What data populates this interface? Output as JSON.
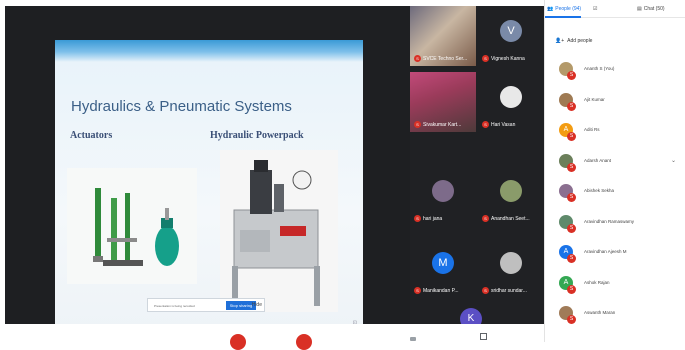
{
  "slide": {
    "title": "Hydraulics & Pneumatic Systems",
    "left_subtitle": "Actuators",
    "right_subtitle": "Hydraulic Powerpack",
    "popup_message": "Presentation is being recorded",
    "popup_button": "Stop sharing",
    "popup_close": "Hide"
  },
  "grid_tiles": [
    {
      "name": "SVCE Techno Ser...",
      "type": "camera",
      "mic": "S"
    },
    {
      "name": "Vignesh Kanna",
      "type": "avatar",
      "letter": "V",
      "color": "#7a8aa8",
      "mic": "S"
    },
    {
      "name": "Sivakumar Kart...",
      "type": "camera",
      "mic": "S"
    },
    {
      "name": "Hari Vasan",
      "type": "photo",
      "mic": "S"
    },
    {
      "name": "hari jana",
      "type": "photo",
      "mic": "S"
    },
    {
      "name": "Anandhan Seet...",
      "type": "photo",
      "mic": "S"
    },
    {
      "name": "Manikandan P...",
      "type": "avatar",
      "letter": "M",
      "color": "#1a73e8",
      "mic": "S"
    },
    {
      "name": "sridhar sundar...",
      "type": "photo",
      "mic": "S"
    }
  ],
  "bottom_tile_letter": "K",
  "panel": {
    "tabs": [
      {
        "label": "People (94)",
        "icon": "people-icon"
      },
      {
        "label": "",
        "icon": "chat-bubble-icon"
      },
      {
        "label": "Chat (50)",
        "icon": "chat-icon"
      }
    ],
    "add_people": "Add people",
    "people": [
      {
        "name": "Ananth S (You)",
        "avatar": "photo",
        "color": "#b49a6a"
      },
      {
        "name": "Ajit Kumar",
        "avatar": "photo",
        "color": "#9f7a53"
      },
      {
        "name": "Aditi Rs",
        "avatar": "letter",
        "letter": "A",
        "color": "#f39c12"
      },
      {
        "name": "Adarsh Anant",
        "avatar": "photo",
        "color": "#6b7f5a",
        "chevron": true
      },
      {
        "name": "Abishek Sekha",
        "avatar": "photo",
        "color": "#8b6f90"
      },
      {
        "name": "Aravindhan Ramaswamy",
        "avatar": "photo",
        "color": "#5f8a6b"
      },
      {
        "name": "Aravindhan Ajeesh M",
        "avatar": "letter",
        "letter": "A",
        "color": "#1a73e8"
      },
      {
        "name": "Ashok Rajan",
        "avatar": "letter",
        "letter": "A",
        "color": "#34a853"
      },
      {
        "name": "Aswanth Maran",
        "avatar": "photo",
        "color": "#a07b58"
      }
    ]
  }
}
